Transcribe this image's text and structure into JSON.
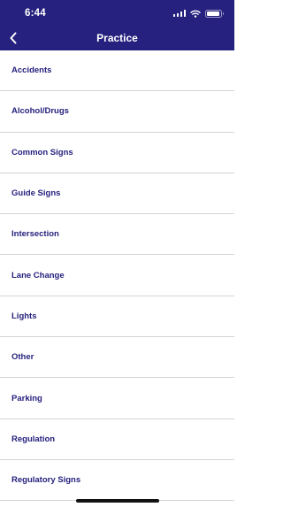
{
  "status_bar": {
    "time": "6:44"
  },
  "nav": {
    "title": "Practice",
    "back_icon": "chevron-left-icon"
  },
  "items": [
    {
      "label": "Accidents"
    },
    {
      "label": "Alcohol/Drugs"
    },
    {
      "label": "Common Signs"
    },
    {
      "label": "Guide Signs"
    },
    {
      "label": "Intersection"
    },
    {
      "label": "Lane Change"
    },
    {
      "label": "Lights"
    },
    {
      "label": "Other"
    },
    {
      "label": "Parking"
    },
    {
      "label": "Regulation"
    },
    {
      "label": "Regulatory Signs"
    }
  ],
  "colors": {
    "header": "#26217e",
    "item_text": "#26217e",
    "divider": "#d4d4d8"
  }
}
